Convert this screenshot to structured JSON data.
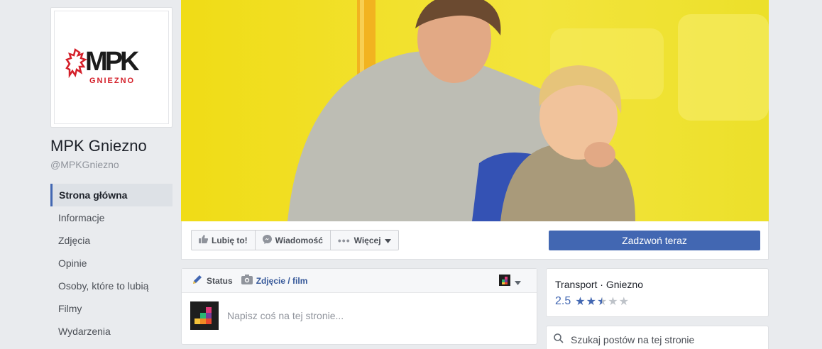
{
  "page": {
    "name": "MPK Gniezno",
    "handle": "@MPKGniezno",
    "logo": {
      "mark": "MPK",
      "sub": "GNIEZNO"
    }
  },
  "nav": [
    {
      "label": "Strona główna",
      "active": true
    },
    {
      "label": "Informacje"
    },
    {
      "label": "Zdjęcia"
    },
    {
      "label": "Opinie"
    },
    {
      "label": "Osoby, które to lubią"
    },
    {
      "label": "Filmy"
    },
    {
      "label": "Wydarzenia"
    }
  ],
  "actions": {
    "like": "Lubię to!",
    "message": "Wiadomość",
    "more": "Więcej",
    "call": "Zadzwoń teraz"
  },
  "composer": {
    "tab_status": "Status",
    "tab_media": "Zdjęcie / film",
    "placeholder": "Napisz coś na tej stronie..."
  },
  "about": {
    "category": "Transport · Gniezno",
    "rating": "2.5",
    "rating_fraction": 0.5,
    "stars_filled": 2.5,
    "stars_total": 5
  },
  "search": {
    "placeholder": "Szukaj postów na tej stronie"
  },
  "colors": {
    "accent": "#4267b2",
    "cover_yellow": "#f1de1a",
    "logo_red": "#d4202a"
  }
}
